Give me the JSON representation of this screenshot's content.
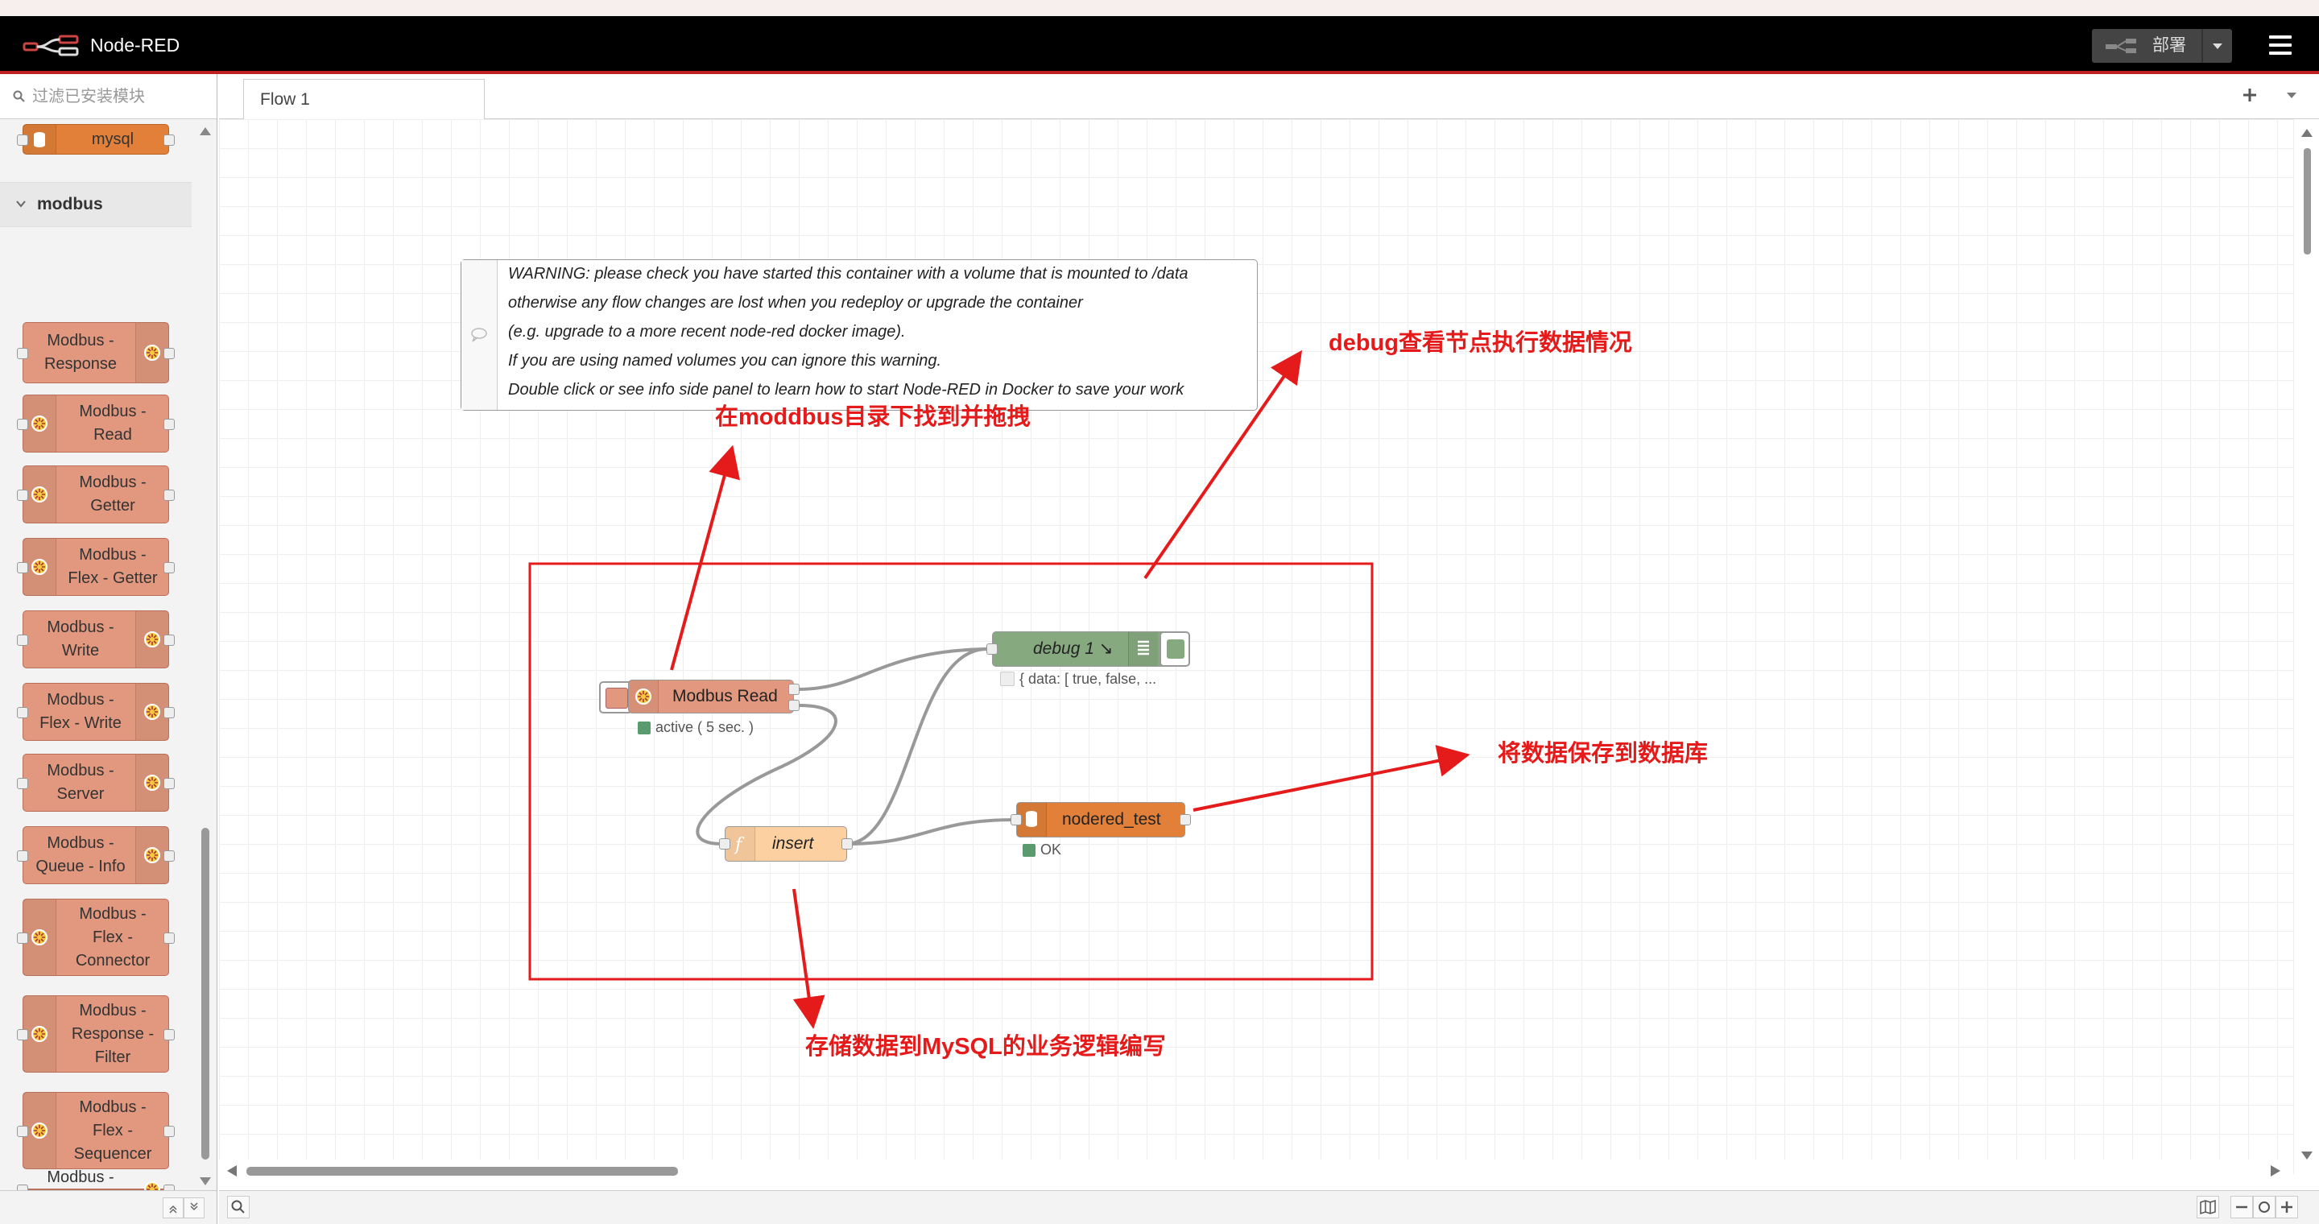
{
  "app": {
    "title": "Node-RED"
  },
  "header": {
    "deploy_label": "部署"
  },
  "palette": {
    "search_placeholder": "过滤已安装模块",
    "category": "modbus",
    "mysql_node": "mysql",
    "nodes": [
      {
        "label": "Modbus -\nResponse"
      },
      {
        "label": "Modbus -\nRead"
      },
      {
        "label": "Modbus -\nGetter"
      },
      {
        "label": "Modbus -\nFlex - Getter"
      },
      {
        "label": "Modbus -\nWrite"
      },
      {
        "label": "Modbus -\nFlex - Write"
      },
      {
        "label": "Modbus -\nServer"
      },
      {
        "label": "Modbus -\nQueue - Info"
      },
      {
        "label": "Modbus -\nFlex -\nConnector"
      },
      {
        "label": "Modbus -\nResponse -\nFilter"
      },
      {
        "label": "Modbus -\nFlex -\nSequencer"
      },
      {
        "label": "Modbus -\nFlex - FC"
      }
    ]
  },
  "tabs": [
    {
      "label": "Flow 1"
    }
  ],
  "comment": {
    "lines": [
      "WARNING: please check you have started this container with a volume that is mounted to /data",
      "otherwise any flow changes are lost when you redeploy or upgrade the container",
      "(e.g. upgrade to a more recent node-red docker image).",
      "If you are using named volumes you can ignore this warning.",
      "Double click or see info side panel to learn how to start Node-RED in Docker to save your work"
    ]
  },
  "flow": {
    "modbus_read": {
      "label": "Modbus Read",
      "status": "active ( 5 sec. )",
      "status_color": "#5a9a6e"
    },
    "debug": {
      "label": "debug 1",
      "status": "{ data: [ true, false, ..."
    },
    "function": {
      "label": "insert"
    },
    "mysql": {
      "label": "nodered_test",
      "status": "OK",
      "status_color": "#5a9a6e"
    }
  },
  "annotations": {
    "drag": "在moddbus目录下找到并拖拽",
    "debug": "debug查看节点执行数据情况",
    "save": "将数据保存到数据库",
    "store": "存储数据到MySQL的业务逻辑编写"
  },
  "colors": {
    "accent_red": "#e51b1b",
    "modbus_node": "#e2987f",
    "debug_node": "#87a980",
    "function_node": "#fdd0a2",
    "mysql_node": "#e2803a"
  }
}
